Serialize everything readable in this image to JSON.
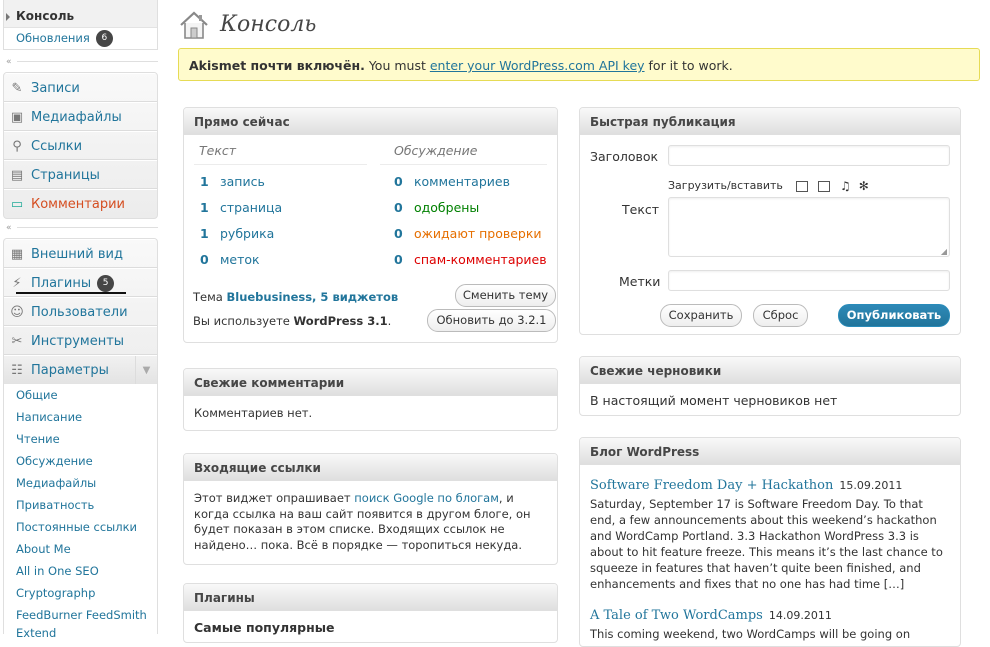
{
  "menu": {
    "dashboard": {
      "current": "Консоль",
      "updates": "Обновления",
      "updates_count": "6"
    },
    "items1": [
      {
        "label": "Записи",
        "icon": "pin-icon"
      },
      {
        "label": "Медиафайлы",
        "icon": "media-icon"
      },
      {
        "label": "Ссылки",
        "icon": "links-icon"
      },
      {
        "label": "Страницы",
        "icon": "pages-icon"
      },
      {
        "label": "Комментарии",
        "icon": "comments-icon"
      }
    ],
    "items2": [
      {
        "label": "Внешний вид",
        "icon": "appearance-icon"
      },
      {
        "label": "Плагины",
        "icon": "plugins-icon",
        "count": "5"
      },
      {
        "label": "Пользователи",
        "icon": "users-icon"
      },
      {
        "label": "Инструменты",
        "icon": "tools-icon"
      },
      {
        "label": "Параметры",
        "icon": "settings-icon"
      }
    ],
    "settings_sub": [
      "Общие",
      "Написание",
      "Чтение",
      "Обсуждение",
      "Медиафайлы",
      "Приватность",
      "Постоянные ссылки",
      "About Me",
      "All in One SEO",
      "Cryptographp",
      "FeedBurner FeedSmith",
      "Extend"
    ]
  },
  "page": {
    "title": "Консоль"
  },
  "notice": {
    "bold": "Akismet почти включён.",
    "pre": " You must ",
    "link": "enter your WordPress.com API key",
    "post": " for it to work."
  },
  "right_now": {
    "title": "Прямо сейчас",
    "content_head": "Текст",
    "discussion_head": "Обсуждение",
    "content": [
      {
        "num": "1",
        "label": "запись"
      },
      {
        "num": "1",
        "label": "страница"
      },
      {
        "num": "1",
        "label": "рубрика"
      },
      {
        "num": "0",
        "label": "меток"
      }
    ],
    "discussion": [
      {
        "num": "0",
        "label": "комментариев"
      },
      {
        "num": "0",
        "label": "одобрены"
      },
      {
        "num": "0",
        "label": "ожидают проверки"
      },
      {
        "num": "0",
        "label": "спам-комментариев"
      }
    ],
    "theme_pre": "Тема ",
    "theme_link": "Bluebusiness, 5 виджетов",
    "change_theme": "Сменить тему",
    "version_pre": "Вы используете ",
    "version": "WordPress 3.1",
    "version_post": ".",
    "update_btn": "Обновить до 3.2.1"
  },
  "recent_comments": {
    "title": "Свежие комментарии",
    "text": "Комментариев нет."
  },
  "incoming_links": {
    "title": "Входящие ссылки",
    "pre": "Этот виджет опрашивает ",
    "link": "поиск Google по блогам",
    "post": ", и когда ссылка на ваш сайт появится в другом блоге, он будет показан в этом списке. Входящих ссылок не найдено… пока. Всё в порядке — торопиться некуда."
  },
  "plugins": {
    "title": "Плагины",
    "popular": "Самые популярные"
  },
  "quick_press": {
    "title": "Быстрая публикация",
    "title_label": "Заголовок",
    "upload_label": "Загрузить/вставить",
    "text_label": "Текст",
    "tags_label": "Метки",
    "save": "Сохранить",
    "reset": "Сброс",
    "publish": "Опубликовать"
  },
  "drafts": {
    "title": "Свежие черновики",
    "text": "В настоящий момент черновиков нет"
  },
  "blog": {
    "title": "Блог WordPress",
    "posts": [
      {
        "title": "Software Freedom Day + Hackathon",
        "date": "15.09.2011",
        "summary": "Saturday, September 17 is Software Freedom Day. To that end, a few announcements about this weekend’s hackathon and WordCamp Portland. 3.3 Hackathon WordPress 3.3 is about to hit feature freeze. This means it’s the last chance to squeeze in features that haven’t quite been finished, and enhancements and fixes that no one has had time […]"
      },
      {
        "title": "A Tale of Two WordCamps",
        "date": "14.09.2011",
        "summary": "This coming weekend, two WordCamps will be going on"
      }
    ]
  }
}
